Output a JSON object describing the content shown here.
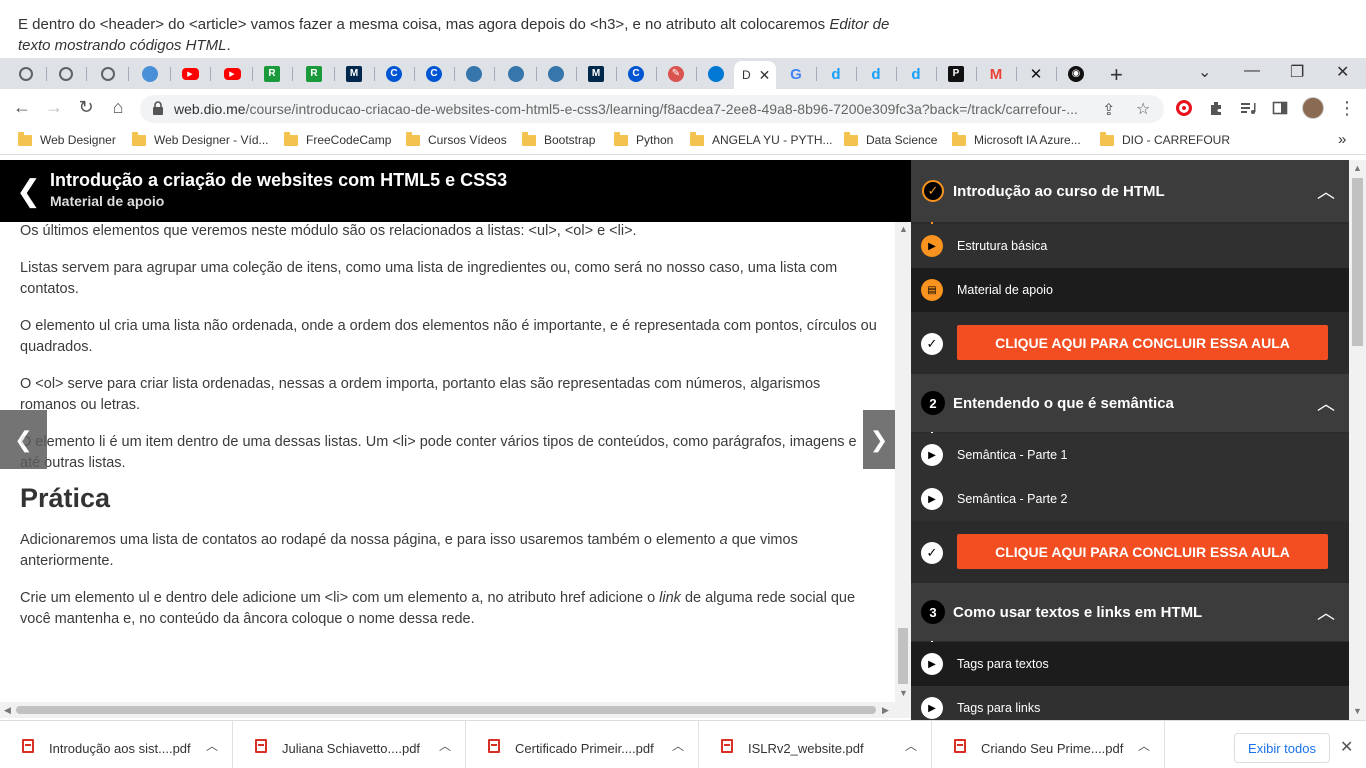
{
  "caption": {
    "part1": "E dentro do <header> do <article> vamos fazer a mesma coisa, mas agora depois do <h3>, e no atributo alt colocaremos ",
    "italic1": "Editor de",
    "line2_italic": "texto mostrando códigos HTML",
    "line2_end": "."
  },
  "tabs": {
    "favicons": [
      {
        "icon": "globe-icon",
        "color": "#5f6368",
        "glyph": ""
      },
      {
        "icon": "globe-icon",
        "color": "#5f6368",
        "glyph": ""
      },
      {
        "icon": "globe-icon",
        "color": "#5f6368",
        "glyph": ""
      },
      {
        "icon": "cloud-icon",
        "color": "#4a90d9",
        "glyph": ""
      },
      {
        "icon": "youtube-icon",
        "color": "#ff0000",
        "glyph": "▶"
      },
      {
        "icon": "youtube-icon",
        "color": "#ff0000",
        "glyph": "▶"
      },
      {
        "icon": "rc-icon",
        "color": "#1a9a3b",
        "glyph": "R"
      },
      {
        "icon": "rc-icon",
        "color": "#1a9a3b",
        "glyph": "R"
      },
      {
        "icon": "michigan-icon",
        "color": "#00274c",
        "glyph": "M"
      },
      {
        "icon": "coursera-icon",
        "color": "#0056d2",
        "glyph": "C"
      },
      {
        "icon": "coursera-icon",
        "color": "#0056d2",
        "glyph": "C"
      },
      {
        "icon": "python-icon",
        "color": "#3776ab",
        "glyph": ""
      },
      {
        "icon": "python-icon",
        "color": "#3776ab",
        "glyph": ""
      },
      {
        "icon": "python-icon",
        "color": "#3776ab",
        "glyph": ""
      },
      {
        "icon": "michigan-icon",
        "color": "#00274c",
        "glyph": "M"
      },
      {
        "icon": "coursera-icon",
        "color": "#0056d2",
        "glyph": "C"
      },
      {
        "icon": "edit-icon",
        "color": "#d9534f",
        "glyph": "✎"
      },
      {
        "icon": "azure-icon",
        "color": "#0078d4",
        "glyph": ""
      },
      {
        "icon": "google-icon",
        "color": "#4285f4",
        "glyph": "G"
      },
      {
        "icon": "dio-icon",
        "color": "#18a0fb",
        "glyph": "d"
      },
      {
        "icon": "dio-icon",
        "color": "#18a0fb",
        "glyph": "d"
      },
      {
        "icon": "dio-icon",
        "color": "#18a0fb",
        "glyph": "d"
      },
      {
        "icon": "p-icon",
        "color": "#111111",
        "glyph": "P"
      },
      {
        "icon": "gmail-icon",
        "color": "#ea4335",
        "glyph": "M"
      },
      {
        "icon": "x-icon",
        "color": "#111111",
        "glyph": "✕"
      },
      {
        "icon": "github-icon",
        "color": "#111111",
        "glyph": "◉"
      }
    ],
    "active_label": "D",
    "active_close": "✕",
    "new_tab": "+"
  },
  "window": {
    "minimize": "—",
    "maximize": "❐",
    "close": "✕",
    "dropdown": "⌄"
  },
  "toolbar": {
    "back": "←",
    "forward": "→",
    "reload": "↻",
    "home": "⌂",
    "url_host": "web.dio.me",
    "url_path": "/course/introducao-criacao-de-websites-com-html5-e-css3/learning/f8acdea7-2ee8-49a8-8b96-7200e309fc3a?back=/track/carrefour-...",
    "share": "⇪",
    "star": "☆",
    "menu": "⋮"
  },
  "bookmarks": [
    "Web Designer",
    "Web Designer - Víd...",
    "FreeCodeCamp",
    "Cursos Vídeos",
    "Bootstrap",
    "Python",
    "ANGELA YU - PYTH...",
    "Data Science",
    "Microsoft IA Azure...",
    "DIO - CARREFOUR"
  ],
  "bookmarks_more": "»",
  "course": {
    "title": "Introdução a criação de websites com HTML5 e CSS3",
    "subtitle": "Material de apoio",
    "back": "❮"
  },
  "content": {
    "p1": "Os últimos elementos que veremos neste módulo são os relacionados a listas: <ul>, <ol> e <li>.",
    "p2": "Listas servem para agrupar uma coleção de itens, como uma lista de ingredientes ou, como será no nosso caso, uma lista com contatos.",
    "p3": "O elemento ul cria uma lista não ordenada, onde a ordem dos elementos não é importante, e é representada com pontos, círculos ou quadrados.",
    "p4": "O <ol> serve para criar lista ordenadas, nessas a ordem importa, portanto elas são representadas com números, algarismos romanos ou letras.",
    "p5": "O elemento li é um item dentro de uma dessas listas. Um <li> pode conter vários tipos de conteúdos, como parágrafos, imagens e até outras listas.",
    "heading": "Prática",
    "p6a": "Adicionaremos uma lista de contatos ao rodapé da nossa página, e para isso usaremos também o elemento ",
    "p6i": "a",
    "p6b": " que vimos anteriormente.",
    "p7a": "Crie um elemento ul e dentro dele adicione um <li> com um elemento a, no atributo href adicione o ",
    "p7i": "link",
    "p7b": " de alguma rede social que você mantenha e, no conteúdo da âncora coloque o nome dessa rede.",
    "prev": "❮",
    "next": "❯"
  },
  "sidebar": {
    "modules": [
      {
        "badge": "✓",
        "title": "Introdução ao curso de HTML",
        "lessons": [
          "Estrutura básica",
          "Material de apoio"
        ],
        "cta": "CLIQUE AQUI PARA CONCLUIR ESSA AULA"
      },
      {
        "badge": "2",
        "title": "Entendendo o que é semântica",
        "lessons": [
          "Semântica - Parte 1",
          "Semântica - Parte 2"
        ],
        "cta": "CLIQUE AQUI PARA CONCLUIR ESSA AULA"
      },
      {
        "badge": "3",
        "title": "Como usar textos e links em HTML",
        "lessons": [
          "Tags para textos",
          "Tags para links"
        ]
      }
    ],
    "collapse": "︿",
    "accent": "#f24e22",
    "orange": "#f7931e"
  },
  "downloads": {
    "items": [
      "Introdução aos sist....pdf",
      "Juliana Schiavetto....pdf",
      "Certificado Primeir....pdf",
      "ISLRv2_website.pdf",
      "Criando Seu Prime....pdf"
    ],
    "chevron": "︿",
    "show_all": "Exibir todos",
    "close": "✕"
  }
}
